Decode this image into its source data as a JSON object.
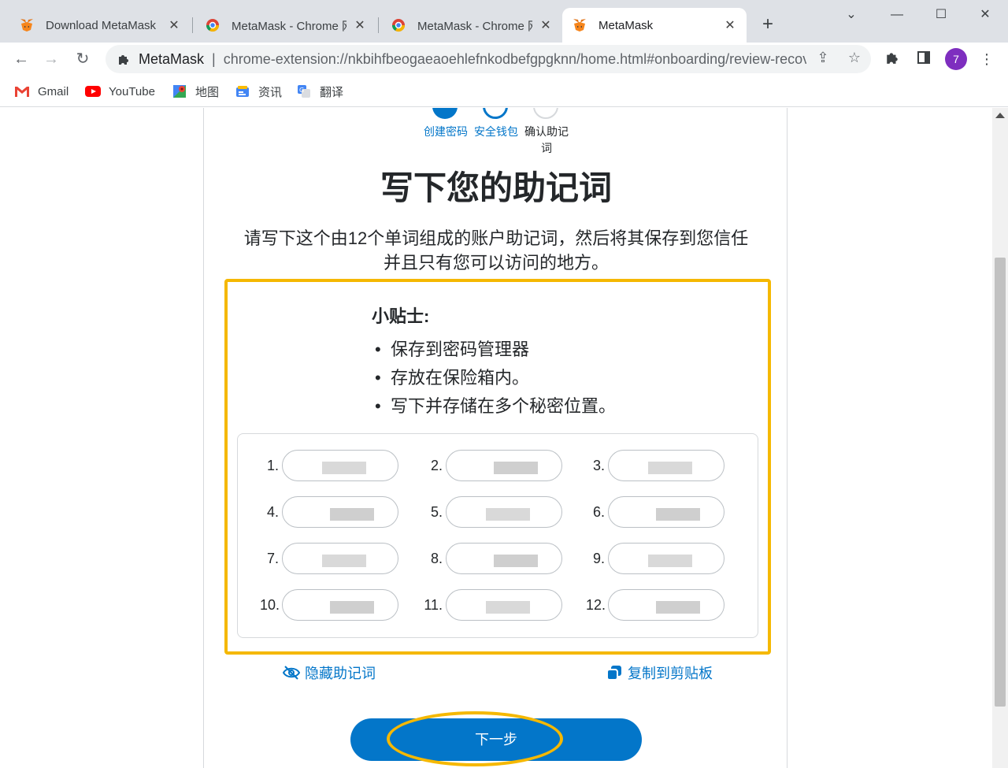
{
  "browser": {
    "tabs": [
      {
        "title": "Download MetaMask",
        "icon": "metamask-fox-icon",
        "active": false
      },
      {
        "title": "MetaMask - Chrome 网上应用店",
        "icon": "chrome-webstore-icon",
        "active": false
      },
      {
        "title": "MetaMask - Chrome 网上应用店",
        "icon": "chrome-webstore-icon",
        "active": false
      },
      {
        "title": "MetaMask",
        "icon": "metamask-fox-icon",
        "active": true
      }
    ],
    "new_tab": "+",
    "omnibox": {
      "site": "MetaMask",
      "separator": "|",
      "url": "chrome-extension://nkbihfbeogaeaoehlefnkodbefgpgknn/home.html#onboarding/review-recovery-phrase"
    },
    "profile_initial": "7",
    "bookmarks": [
      {
        "label": "Gmail",
        "icon": "gmail-icon"
      },
      {
        "label": "YouTube",
        "icon": "youtube-icon"
      },
      {
        "label": "地图",
        "icon": "maps-icon"
      },
      {
        "label": "资讯",
        "icon": "news-icon"
      },
      {
        "label": "翻译",
        "icon": "translate-icon"
      }
    ]
  },
  "page": {
    "steps": [
      {
        "label": "创建密码",
        "state": "done"
      },
      {
        "label": "安全钱包",
        "state": "done"
      },
      {
        "label": "确认助记词",
        "state": "pending"
      }
    ],
    "title": "写下您的助记词",
    "description": "请写下这个由12个单词组成的账户助记词，然后将其保存到您信任并且只有您可以访问的地方。",
    "tips": {
      "heading": "小贴士:",
      "items": [
        "保存到密码管理器",
        "存放在保险箱内。",
        "写下并存储在多个秘密位置。"
      ]
    },
    "words": [
      {
        "num": "1."
      },
      {
        "num": "2."
      },
      {
        "num": "3."
      },
      {
        "num": "4."
      },
      {
        "num": "5."
      },
      {
        "num": "6."
      },
      {
        "num": "7."
      },
      {
        "num": "8."
      },
      {
        "num": "9."
      },
      {
        "num": "10."
      },
      {
        "num": "11."
      },
      {
        "num": "12."
      }
    ],
    "hide_label": "隐藏助记词",
    "copy_label": "复制到剪贴板",
    "next_label": "下一步",
    "colors": {
      "accent": "#0376c9",
      "highlight": "#f5b800",
      "text": "#24272a"
    }
  }
}
